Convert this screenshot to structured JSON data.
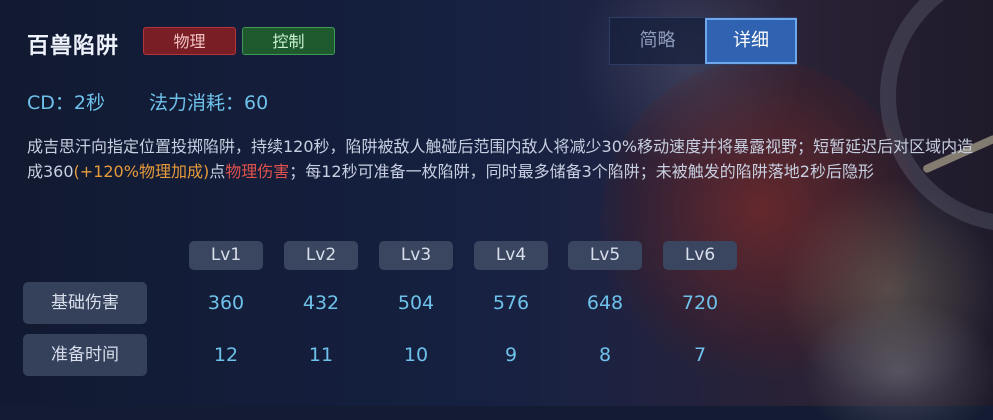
{
  "skill": {
    "name": "百兽陷阱",
    "tags": [
      {
        "label": "物理",
        "color": "#7a1e25"
      },
      {
        "label": "控制",
        "color": "#1e5a2e"
      }
    ]
  },
  "view_toggle": {
    "brief_label": "简略",
    "detail_label": "详细",
    "active": "详细"
  },
  "stats": {
    "cd": "CD：2秒",
    "mana": "法力消耗：60"
  },
  "description": {
    "part1": "成吉思汗向指定位置投掷陷阱，持续120秒，陷阱被敌人触碰后范围内敌人将减少30%移动速度并将暴露视野；短暂延迟后对区域内造成360",
    "bonus": "(+120%物理加成)",
    "part2": "点",
    "damage_type": "物理伤害",
    "part3": "；每12秒可准备一枚陷阱，同时最多储备3个陷阱；未被触发的陷阱落地2秒后隐形"
  },
  "levels": [
    "Lv1",
    "Lv2",
    "Lv3",
    "Lv4",
    "Lv5",
    "Lv6"
  ],
  "rows": [
    {
      "label": "基础伤害",
      "values": [
        "360",
        "432",
        "504",
        "576",
        "648",
        "720"
      ]
    },
    {
      "label": "准备时间",
      "values": [
        "12",
        "11",
        "10",
        "9",
        "8",
        "7"
      ]
    }
  ]
}
